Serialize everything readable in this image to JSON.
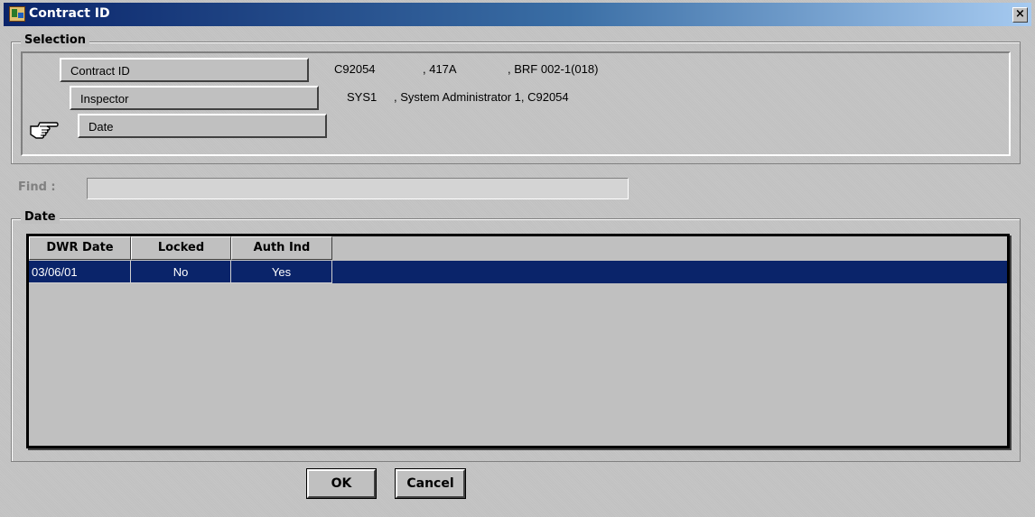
{
  "window": {
    "title": "Contract ID",
    "close_label": "×"
  },
  "selection": {
    "label": "Selection",
    "contract": {
      "label": "Contract ID",
      "id": "C92054",
      "code": ", 417A",
      "project": ", BRF 002-1(018)"
    },
    "inspector": {
      "label": "Inspector",
      "id": "SYS1",
      "name": ", System Administrator 1, C92054"
    },
    "date": {
      "label": "Date"
    },
    "pointer_icon": "pointing-hand-icon"
  },
  "find": {
    "label": "Find :",
    "value": ""
  },
  "date_group": {
    "label": "Date",
    "columns": [
      "DWR Date",
      "Locked",
      "Auth Ind"
    ],
    "rows": [
      {
        "dwr_date": "03/06/01",
        "locked": "No",
        "auth_ind": "Yes"
      }
    ]
  },
  "buttons": {
    "ok": "OK",
    "cancel": "Cancel"
  },
  "colors": {
    "title_bar": "#0a246a",
    "selected_row": "#0a246a",
    "face": "#c0c0c0"
  }
}
